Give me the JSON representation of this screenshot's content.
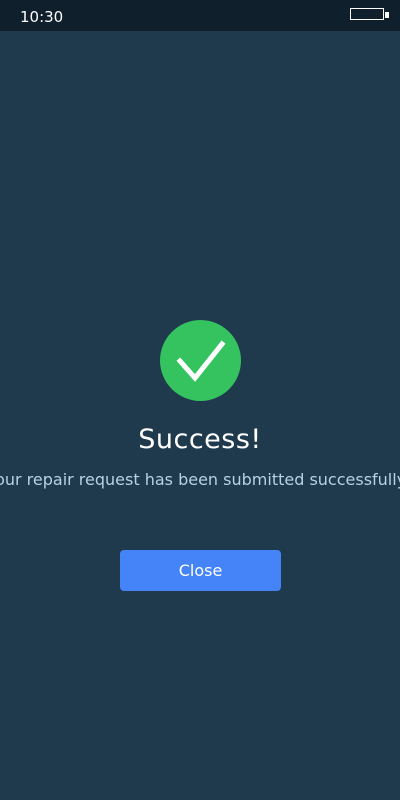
{
  "status_bar": {
    "time": "10:30",
    "battery_icon": "battery-icon"
  },
  "dialog": {
    "icon": "checkmark-icon",
    "title": "Success!",
    "message": "Your repair request has been submitted successfully!",
    "close_label": "Close"
  },
  "colors": {
    "background": "#1f3a4d",
    "status_bar": "#0f1f2b",
    "success_green": "#34c35f",
    "button_blue": "#4583f9",
    "message_text": "#b7d0e6"
  }
}
